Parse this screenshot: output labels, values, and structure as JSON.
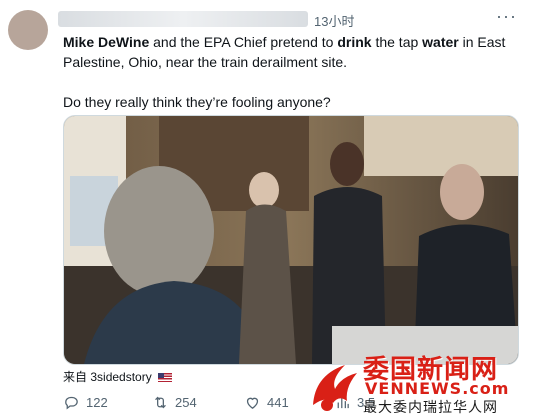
{
  "tweet": {
    "time": "13小时",
    "text_part1": "Mike DeWine",
    "text_part2": " and the EPA Chief pretend to ",
    "text_part3": "drink",
    "text_part4": " the tap ",
    "text_part5": "water",
    "text_part6": " in East Palestine, Ohio, near the train derailment site.",
    "text_line2": "Do they really think they’re fooling anyone?",
    "source_prefix": "来自",
    "source_account": "3sidedstory"
  },
  "actions": {
    "replies": "122",
    "retweets": "254",
    "likes": "441",
    "views": "3.5"
  },
  "watermark": {
    "cn_title": "委国新闻网",
    "en_title": "VENNEWS.com",
    "cn_sub": "最大委内瑞拉华人网"
  },
  "icons": {
    "more": "more-icon",
    "reply": "reply-icon",
    "retweet": "retweet-icon",
    "like": "heart-icon",
    "views": "views-icon"
  },
  "colors": {
    "text": "#0f1419",
    "secondary": "#536471",
    "watermark_red": "#d92016"
  }
}
